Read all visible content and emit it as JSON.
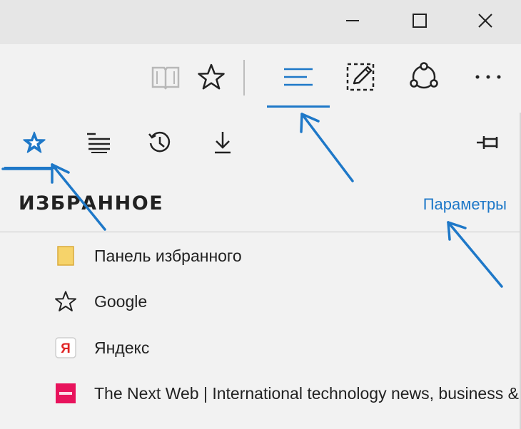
{
  "window": {
    "title_controls": [
      "minimize",
      "maximize",
      "close"
    ]
  },
  "toolbar": {
    "buttons": [
      {
        "name": "reading-view",
        "icon": "book-icon"
      },
      {
        "name": "add-to-favorites",
        "icon": "star-outline-icon"
      },
      {
        "name": "hub",
        "icon": "hamburger-lines-icon",
        "active": true
      },
      {
        "name": "web-note",
        "icon": "pen-frame-icon"
      },
      {
        "name": "share",
        "icon": "share-nodes-icon"
      },
      {
        "name": "more",
        "icon": "ellipsis-icon",
        "label": "···"
      }
    ]
  },
  "hub": {
    "tabs": [
      {
        "name": "favorites",
        "icon": "star-filled-icon",
        "active": true
      },
      {
        "name": "reading-list",
        "icon": "reading-list-icon"
      },
      {
        "name": "history",
        "icon": "history-icon"
      },
      {
        "name": "downloads",
        "icon": "download-icon"
      }
    ],
    "pin_icon": "pin-icon",
    "title": "ИЗБРАННОЕ",
    "settings_link": "Параметры",
    "items": [
      {
        "label": "Панель избранного",
        "icon": "folder-icon"
      },
      {
        "label": "Google",
        "icon": "star-outline-icon"
      },
      {
        "label": "Яндекс",
        "icon": "yandex-icon",
        "icon_letter": "Я"
      },
      {
        "label": "The Next Web | International technology news, business & culture",
        "icon": "tnw-icon"
      }
    ]
  },
  "colors": {
    "accent": "#1e78c8",
    "titlebar_bg": "#e6e6e6",
    "panel_bg": "#f2f2f2",
    "yandex_red": "#e02424",
    "tnw_red": "#e8135c",
    "folder_yellow": "#f6d36a"
  }
}
